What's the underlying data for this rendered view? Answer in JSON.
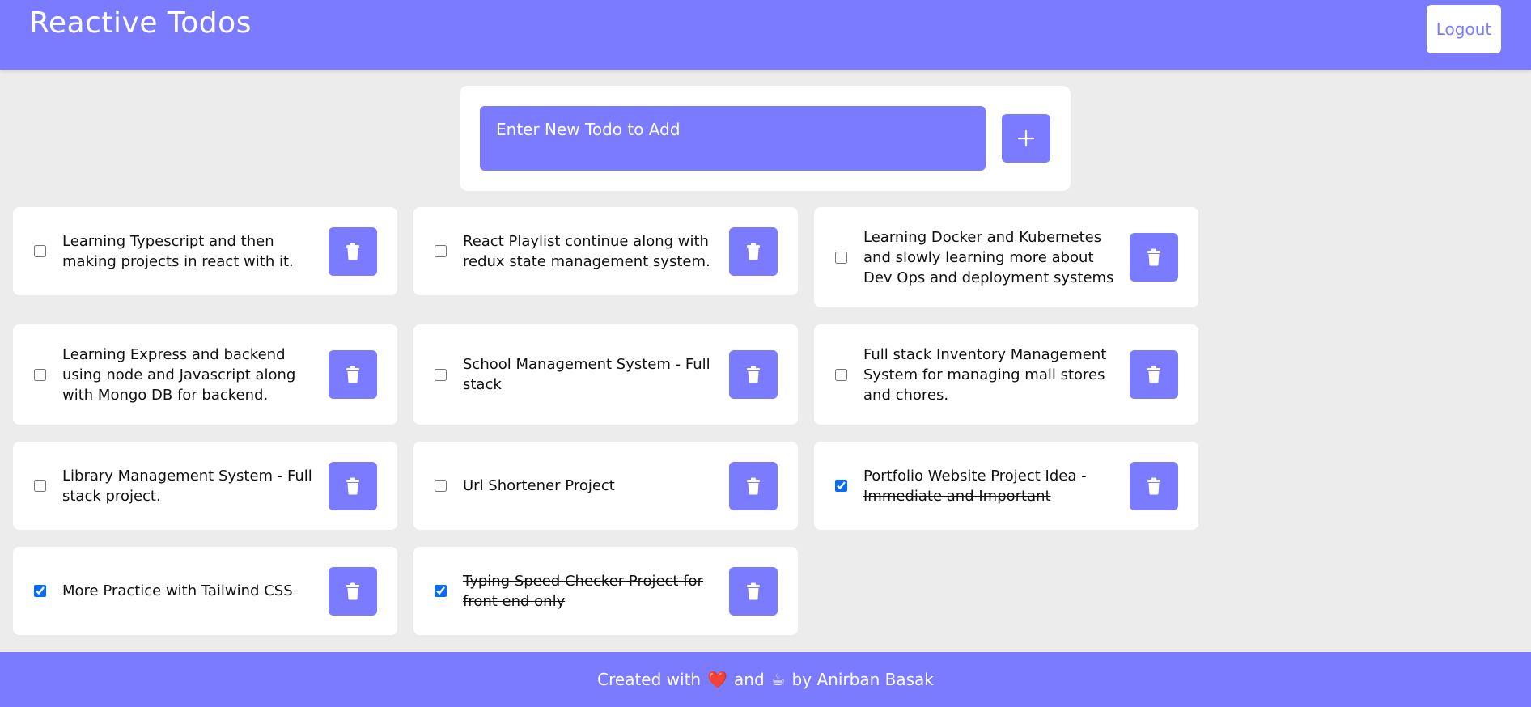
{
  "header": {
    "title": "Reactive Todos",
    "logout_label": "Logout"
  },
  "add_form": {
    "placeholder": "Enter New Todo to Add",
    "add_icon": "plus-icon"
  },
  "todos": [
    {
      "text": "Learning Typescript and then making projects in react with it.",
      "completed": false
    },
    {
      "text": "React Playlist continue along with redux state management system.",
      "completed": false
    },
    {
      "text": "Learning Docker and Kubernetes and slowly learning more about Dev Ops and deployment systems",
      "completed": false
    },
    {
      "text": "Learning Express and backend using node and Javascript along with Mongo DB for backend.",
      "completed": false
    },
    {
      "text": "School Management System - Full stack",
      "completed": false
    },
    {
      "text": "Full stack Inventory Management System for managing mall stores and chores.",
      "completed": false
    },
    {
      "text": "Library Management System - Full stack project.",
      "completed": false
    },
    {
      "text": "Url Shortener Project",
      "completed": false
    },
    {
      "text": "Portfolio Website Project Idea - Immediate and Important",
      "completed": true
    },
    {
      "text": "More Practice with Tailwind CSS",
      "completed": true
    },
    {
      "text": "Typing Speed Checker Project for front end only",
      "completed": true
    }
  ],
  "footer": {
    "prefix": "Created with",
    "heart": "❤️",
    "and": "and",
    "coffee": "☕",
    "suffix": "by Anirban Basak"
  },
  "colors": {
    "accent": "#7b7bff",
    "background": "#ececec",
    "card": "#ffffff",
    "checkbox": "#0a6cf2"
  }
}
